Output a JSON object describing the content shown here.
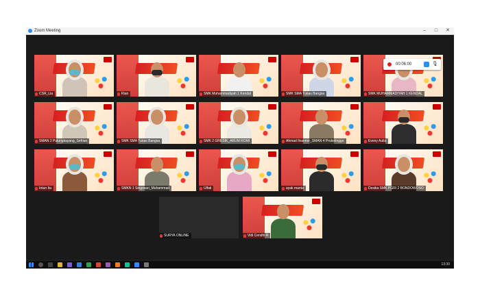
{
  "window": {
    "title": "Zoom Meeting",
    "controls": {
      "minimize": "–",
      "maximize": "□",
      "close": "✕"
    }
  },
  "recording": {
    "time": "00:06:00",
    "mic_glyph": "🎙"
  },
  "participants": [
    {
      "name": "CSR_Lia",
      "style": "hijab",
      "mask": true,
      "shirt": "#d0c4b8"
    },
    {
      "name": "Rian",
      "style": "plain",
      "mask": true,
      "shirt": "#e9e6dd"
    },
    {
      "name": "SMK Muhammadiyah 1 Kendal",
      "style": "plain",
      "mask": false,
      "shirt": "#f1f1f1"
    },
    {
      "name": "SMK SMA Tunas Bangsa",
      "style": "hijab",
      "mask": false,
      "shirt": "#cfd7e6"
    },
    {
      "name": "SMK MUHAMMADIYAH 1 KENDAL",
      "style": "hijab",
      "mask": false,
      "shirt": "#e8b7c4"
    },
    {
      "name": "SMAN 2 Pulungkayang_Sefrian",
      "style": "hijab",
      "mask": false,
      "shirt": "#cfc7b8"
    },
    {
      "name": "SMK SMA Tunas Bangsa",
      "style": "hijab",
      "mask": false,
      "shirt": "#e9e7e2"
    },
    {
      "name": "SMK 2 GRESIK_ARUM ROMI",
      "style": "hijab",
      "mask": false,
      "shirt": "#ece9e3"
    },
    {
      "name": "Ahmad Ilvanner_SMAN 4 Probolinggo",
      "style": "plain",
      "mask": false,
      "shirt": "#8a7a63"
    },
    {
      "name": "Eveny Aulia",
      "style": "plain",
      "mask": true,
      "shirt": "#2e2e2e"
    },
    {
      "name": "Intan Ita",
      "style": "hijab",
      "mask": true,
      "shirt": "#8a5a3a"
    },
    {
      "name": "SMKN 1 Singosari_Muhammad",
      "style": "plain",
      "mask": false,
      "shirt": "#7c7a6a"
    },
    {
      "name": "Ulfati",
      "style": "hijab",
      "mask": true,
      "shirt": "#e6a8c4"
    },
    {
      "name": "ayak manta",
      "style": "plain",
      "mask": true,
      "shirt": "#2b2b2b"
    },
    {
      "name": "Desika SMK PGRI 2 BONDOWOSO",
      "style": "hijab",
      "mask": false,
      "shirt": "#5a3a28"
    },
    {
      "name": "SURYA ONLINE",
      "style": "empty",
      "mask": false,
      "shirt": "#222222"
    },
    {
      "name": "Vidi Cendhi R",
      "style": "plain",
      "mask": false,
      "shirt": "#3c6b3a"
    }
  ],
  "taskbar": {
    "clock": "13:30"
  },
  "colors": {
    "accent_blue": "#2d8cff",
    "recording_red": "#e02020"
  }
}
